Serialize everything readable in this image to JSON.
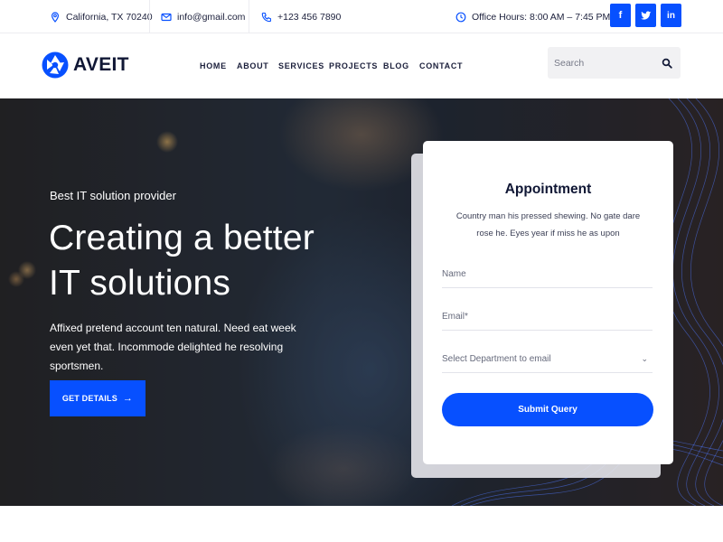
{
  "topbar": {
    "location": "California, TX 70240",
    "email": "info@gmail.com",
    "phone": "+123 456 7890",
    "hours": "Office Hours: 8:00 AM – 7:45 PM",
    "social": [
      {
        "icon": "facebook-icon",
        "label": "f"
      },
      {
        "icon": "twitter-icon",
        "label": "t"
      },
      {
        "icon": "linkedin-icon",
        "label": "in"
      }
    ],
    "accent_color": "#0750ff"
  },
  "header": {
    "logo_text": "AVEIT",
    "nav": [
      "HOME",
      "ABOUT",
      "SERVICES",
      "PROJECTS",
      "BLOG",
      "CONTACT"
    ],
    "search_placeholder": "Search"
  },
  "hero": {
    "subtitle": "Best IT solution provider",
    "title_line1": "Creating a better",
    "title_line2": "IT solutions",
    "description": "Affixed pretend account ten natural. Need eat week even yet that. Incommode delighted he resolving sportsmen.",
    "button_label": "GET DETAILS"
  },
  "appointment": {
    "title": "Appointment",
    "description": "Country man his pressed shewing. No gate dare rose he. Eyes year if miss he as upon",
    "name_placeholder": "Name",
    "email_placeholder": "Email*",
    "department_selected": "Select Department to email",
    "submit_label": "Submit Query"
  }
}
